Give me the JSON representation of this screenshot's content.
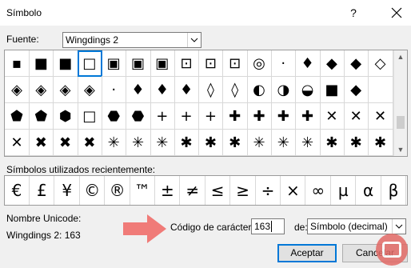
{
  "window": {
    "title": "Símbolo",
    "help": "?"
  },
  "font": {
    "label": "Fuente:",
    "value": "Wingdings 2"
  },
  "grid": {
    "rows": [
      [
        "▪",
        "■",
        "■",
        "□",
        "▣",
        "▣",
        "▣",
        "⊡",
        "⊡",
        "⊡",
        "◎",
        "·",
        "♦",
        "◆",
        "◆",
        "◇"
      ],
      [
        "◈",
        "◈",
        "◈",
        "◈",
        "·",
        "♦",
        "♦",
        "♦",
        "◊",
        "◊",
        "◐",
        "◑",
        "◒",
        "■",
        "◆",
        ""
      ],
      [
        "⬟",
        "⬟",
        "⬢",
        "□",
        "⬣",
        "⬣",
        "+",
        "+",
        "+",
        "✚",
        "✚",
        "✚",
        "✚",
        "✕",
        "✕",
        "✕"
      ],
      [
        "✕",
        "✖",
        "✖",
        "✖",
        "✳",
        "✳",
        "✳",
        "✱",
        "✱",
        "✱",
        "✳",
        "✳",
        "✳",
        "✱",
        "✱",
        "✱"
      ]
    ],
    "selected": {
      "row": 0,
      "col": 3
    }
  },
  "recent": {
    "label": "Símbolos utilizados recientemente:",
    "symbols": [
      "€",
      "£",
      "¥",
      "©",
      "®",
      "™",
      "±",
      "≠",
      "≤",
      "≥",
      "÷",
      "×",
      "∞",
      "µ",
      "α",
      "β"
    ]
  },
  "unicode": {
    "label": "Nombre Unicode:",
    "value": "Wingdings 2: 163"
  },
  "code": {
    "label": "Código de carácter:",
    "value": "163"
  },
  "from": {
    "label": "de:",
    "value": "Símbolo (decimal)"
  },
  "buttons": {
    "ok": "Aceptar",
    "cancel": "Cancelar"
  },
  "colors": {
    "accent": "#0078d7",
    "arrow": "#f07b78"
  }
}
